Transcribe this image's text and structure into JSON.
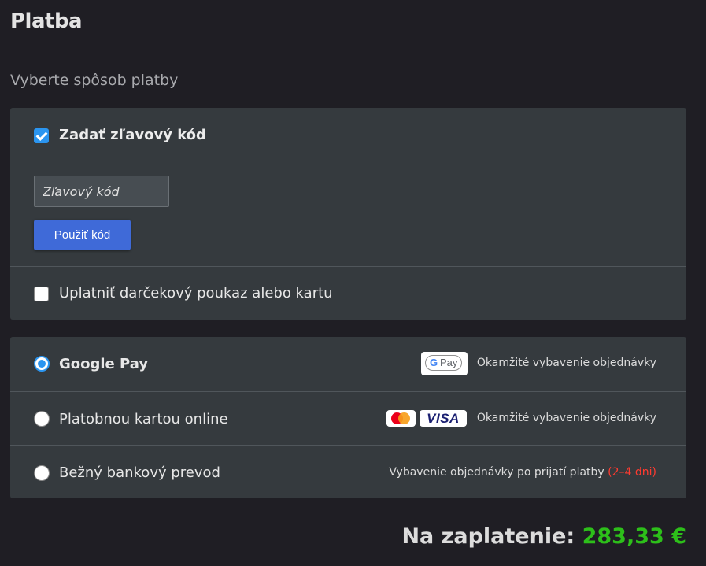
{
  "page": {
    "title": "Platba",
    "subtitle": "Vyberte spôsob platby"
  },
  "discount": {
    "checkbox_label": "Zadať zľavový kód",
    "checked": true,
    "input_placeholder": "Zľavový kód",
    "input_value": "",
    "apply_button": "Použiť kód"
  },
  "gift": {
    "checkbox_label": "Uplatniť darčekový poukaz alebo kartu",
    "checked": false
  },
  "payment_methods": [
    {
      "label": "Google Pay",
      "selected": true,
      "badge": "G Pay",
      "badge_g": "G",
      "badge_pay": "Pay",
      "note": "Okamžité vybavenie objednávky"
    },
    {
      "label": "Platobnou kartou online",
      "selected": false,
      "badge_visa": "VISA",
      "icons": [
        "mastercard-icon",
        "visa-icon"
      ],
      "note": "Okamžité vybavenie objednávky"
    },
    {
      "label": "Bežný bankový prevod",
      "selected": false,
      "note": "Vybavenie objednávky po prijatí platby",
      "note_highlight": "(2–4 dni)"
    }
  ],
  "summary": {
    "label": "Na zaplatenie:",
    "amount": "283,33 €"
  },
  "colors": {
    "background": "#1f1e24",
    "card": "#353a3e",
    "accent": "#2b95f0",
    "button": "#3f6ad8",
    "amount": "#2dbf1a",
    "highlight": "#ff3b30"
  }
}
